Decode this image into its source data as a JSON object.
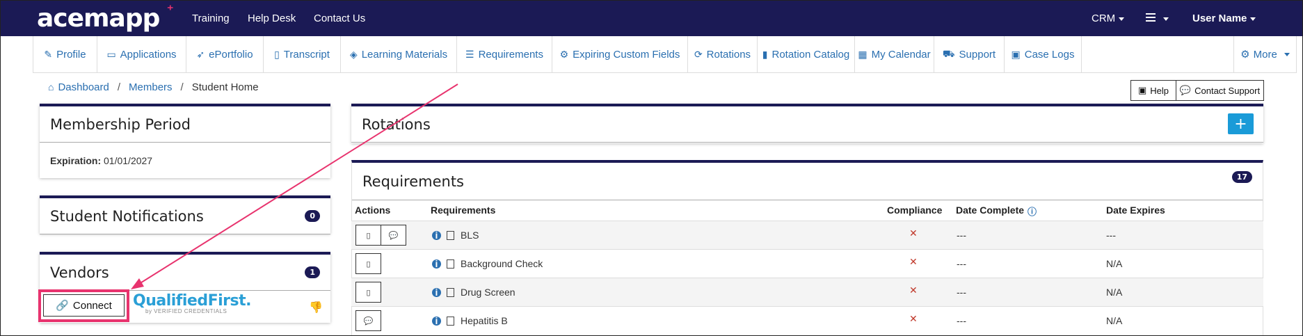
{
  "topnav": {
    "logo": "acemapp",
    "links": [
      "Training",
      "Help Desk",
      "Contact Us"
    ],
    "crm": "CRM",
    "user": "User Name"
  },
  "subnav": {
    "tabs": [
      "Profile",
      "Applications",
      "ePortfolio",
      "Transcript",
      "Learning Materials",
      "Requirements",
      "Expiring Custom Fields",
      "Rotations",
      "Rotation Catalog",
      "My Calendar",
      "Support",
      "Case Logs"
    ],
    "more": "More"
  },
  "breadcrumb": {
    "dashboard": "Dashboard",
    "members": "Members",
    "current": "Student Home"
  },
  "actions": {
    "help": "Help",
    "contact_support": "Contact Support"
  },
  "membership": {
    "title": "Membership Period",
    "expiration_label": "Expiration:",
    "expiration_value": "01/01/2027"
  },
  "notifications": {
    "title": "Student Notifications",
    "count": "0"
  },
  "vendors": {
    "title": "Vendors",
    "count": "1",
    "connect": "Connect",
    "vendor_name": "QualifiedFirst.",
    "vendor_sub": "by VERIFIED CREDENTIALS"
  },
  "rotations": {
    "title": "Rotations",
    "add": "+"
  },
  "requirements": {
    "title": "Requirements",
    "count": "17",
    "columns": [
      "Actions",
      "Requirements",
      "Compliance",
      "Date Complete",
      "Date Expires"
    ],
    "rows": [
      {
        "name": "BLS",
        "compliance": "✕",
        "complete": "---",
        "expires": "---"
      },
      {
        "name": "Background Check",
        "compliance": "✕",
        "complete": "---",
        "expires": "N/A"
      },
      {
        "name": "Drug Screen",
        "compliance": "✕",
        "complete": "---",
        "expires": "N/A"
      },
      {
        "name": "Hepatitis B",
        "compliance": "✕",
        "complete": "---",
        "expires": "N/A"
      }
    ]
  },
  "colors": {
    "navy": "#1b1a55",
    "link": "#2a6fb0",
    "highlight": "#e8336e",
    "accent": "#1a9bd8"
  }
}
